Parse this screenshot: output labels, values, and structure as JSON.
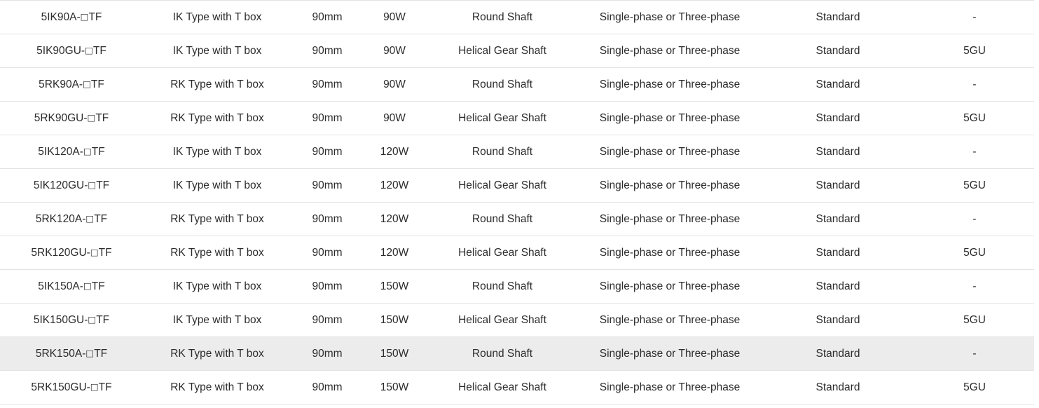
{
  "table": {
    "name": "motor-model-specification-table",
    "hovered_row_index": 10,
    "row_highlight_color": "#ececec",
    "row_divider_color": "#e3e3e3",
    "text_color": "#2b2b2b",
    "columns": [
      {
        "key": "model",
        "name": "model-code"
      },
      {
        "key": "type",
        "name": "motor-type"
      },
      {
        "key": "frame",
        "name": "frame-size"
      },
      {
        "key": "output",
        "name": "output-power"
      },
      {
        "key": "shaft",
        "name": "shaft-type"
      },
      {
        "key": "phase",
        "name": "power-supply-phase"
      },
      {
        "key": "gearbox",
        "name": "gearbox-grade"
      },
      {
        "key": "gearhead",
        "name": "gearhead-model"
      }
    ],
    "rows": [
      {
        "model": "5IK90A-□TF",
        "type": "IK Type with T box",
        "frame": "90mm",
        "output": "90W",
        "shaft": "Round Shaft",
        "phase": "Single-phase or Three-phase",
        "gearbox": "Standard",
        "gearhead": "-"
      },
      {
        "model": "5IK90GU-□TF",
        "type": "IK Type with T box",
        "frame": "90mm",
        "output": "90W",
        "shaft": "Helical Gear Shaft",
        "phase": "Single-phase or Three-phase",
        "gearbox": "Standard",
        "gearhead": "5GU"
      },
      {
        "model": "5RK90A-□TF",
        "type": "RK Type with T box",
        "frame": "90mm",
        "output": "90W",
        "shaft": "Round Shaft",
        "phase": "Single-phase or Three-phase",
        "gearbox": "Standard",
        "gearhead": "-"
      },
      {
        "model": "5RK90GU-□TF",
        "type": "RK Type with T box",
        "frame": "90mm",
        "output": "90W",
        "shaft": "Helical Gear Shaft",
        "phase": "Single-phase or Three-phase",
        "gearbox": "Standard",
        "gearhead": "5GU"
      },
      {
        "model": "5IK120A-□TF",
        "type": "IK Type with T box",
        "frame": "90mm",
        "output": "120W",
        "shaft": "Round Shaft",
        "phase": "Single-phase or Three-phase",
        "gearbox": "Standard",
        "gearhead": "-"
      },
      {
        "model": "5IK120GU-□TF",
        "type": "IK Type with T box",
        "frame": "90mm",
        "output": "120W",
        "shaft": "Helical Gear Shaft",
        "phase": "Single-phase or Three-phase",
        "gearbox": "Standard",
        "gearhead": "5GU"
      },
      {
        "model": "5RK120A-□TF",
        "type": "RK Type with T box",
        "frame": "90mm",
        "output": "120W",
        "shaft": "Round Shaft",
        "phase": "Single-phase or Three-phase",
        "gearbox": "Standard",
        "gearhead": "-"
      },
      {
        "model": "5RK120GU-□TF",
        "type": "RK Type with T box",
        "frame": "90mm",
        "output": "120W",
        "shaft": "Helical Gear Shaft",
        "phase": "Single-phase or Three-phase",
        "gearbox": "Standard",
        "gearhead": "5GU"
      },
      {
        "model": "5IK150A-□TF",
        "type": "IK Type with T box",
        "frame": "90mm",
        "output": "150W",
        "shaft": "Round Shaft",
        "phase": "Single-phase or Three-phase",
        "gearbox": "Standard",
        "gearhead": "-"
      },
      {
        "model": "5IK150GU-□TF",
        "type": "IK Type with T box",
        "frame": "90mm",
        "output": "150W",
        "shaft": "Helical Gear Shaft",
        "phase": "Single-phase or Three-phase",
        "gearbox": "Standard",
        "gearhead": "5GU"
      },
      {
        "model": "5RK150A-□TF",
        "type": "RK Type with T box",
        "frame": "90mm",
        "output": "150W",
        "shaft": "Round Shaft",
        "phase": "Single-phase or Three-phase",
        "gearbox": "Standard",
        "gearhead": "-"
      },
      {
        "model": "5RK150GU-□TF",
        "type": "RK Type with T box",
        "frame": "90mm",
        "output": "150W",
        "shaft": "Helical Gear Shaft",
        "phase": "Single-phase or Three-phase",
        "gearbox": "Standard",
        "gearhead": "5GU"
      }
    ]
  }
}
